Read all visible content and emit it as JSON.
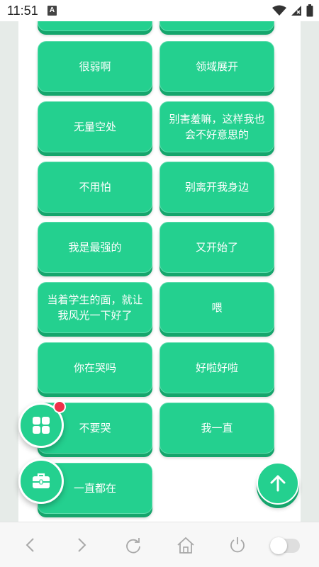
{
  "status_bar": {
    "time": "11:51",
    "notification_glyph": "A",
    "icons": [
      "wifi-icon",
      "cell-signal-icon",
      "battery-icon"
    ]
  },
  "grid": {
    "buttons": [
      "",
      "",
      "很弱啊",
      "领域展开",
      "无量空处",
      "别害羞嘛，这样我也会不好意思的",
      "不用怕",
      "别离开我身边",
      "我是最强的",
      "又开始了",
      "当着学生的面，就让我风光一下好了",
      "喂",
      "你在哭吗",
      "好啦好啦",
      "不要哭",
      "我一直",
      "一直都在"
    ]
  },
  "floating": {
    "grid_menu_icon": "grid-icon",
    "toolbox_icon": "toolbox-icon",
    "scroll_top_icon": "arrow-up-icon"
  },
  "nav_bar": {
    "items": [
      "back-icon",
      "forward-icon",
      "refresh-icon",
      "home-icon",
      "power-icon"
    ],
    "toggle_on": false
  },
  "colors": {
    "accent": "#24d08f",
    "accent_shadow": "#15a56c",
    "badge": "#f0304a",
    "page_background": "#e6ebe8"
  }
}
